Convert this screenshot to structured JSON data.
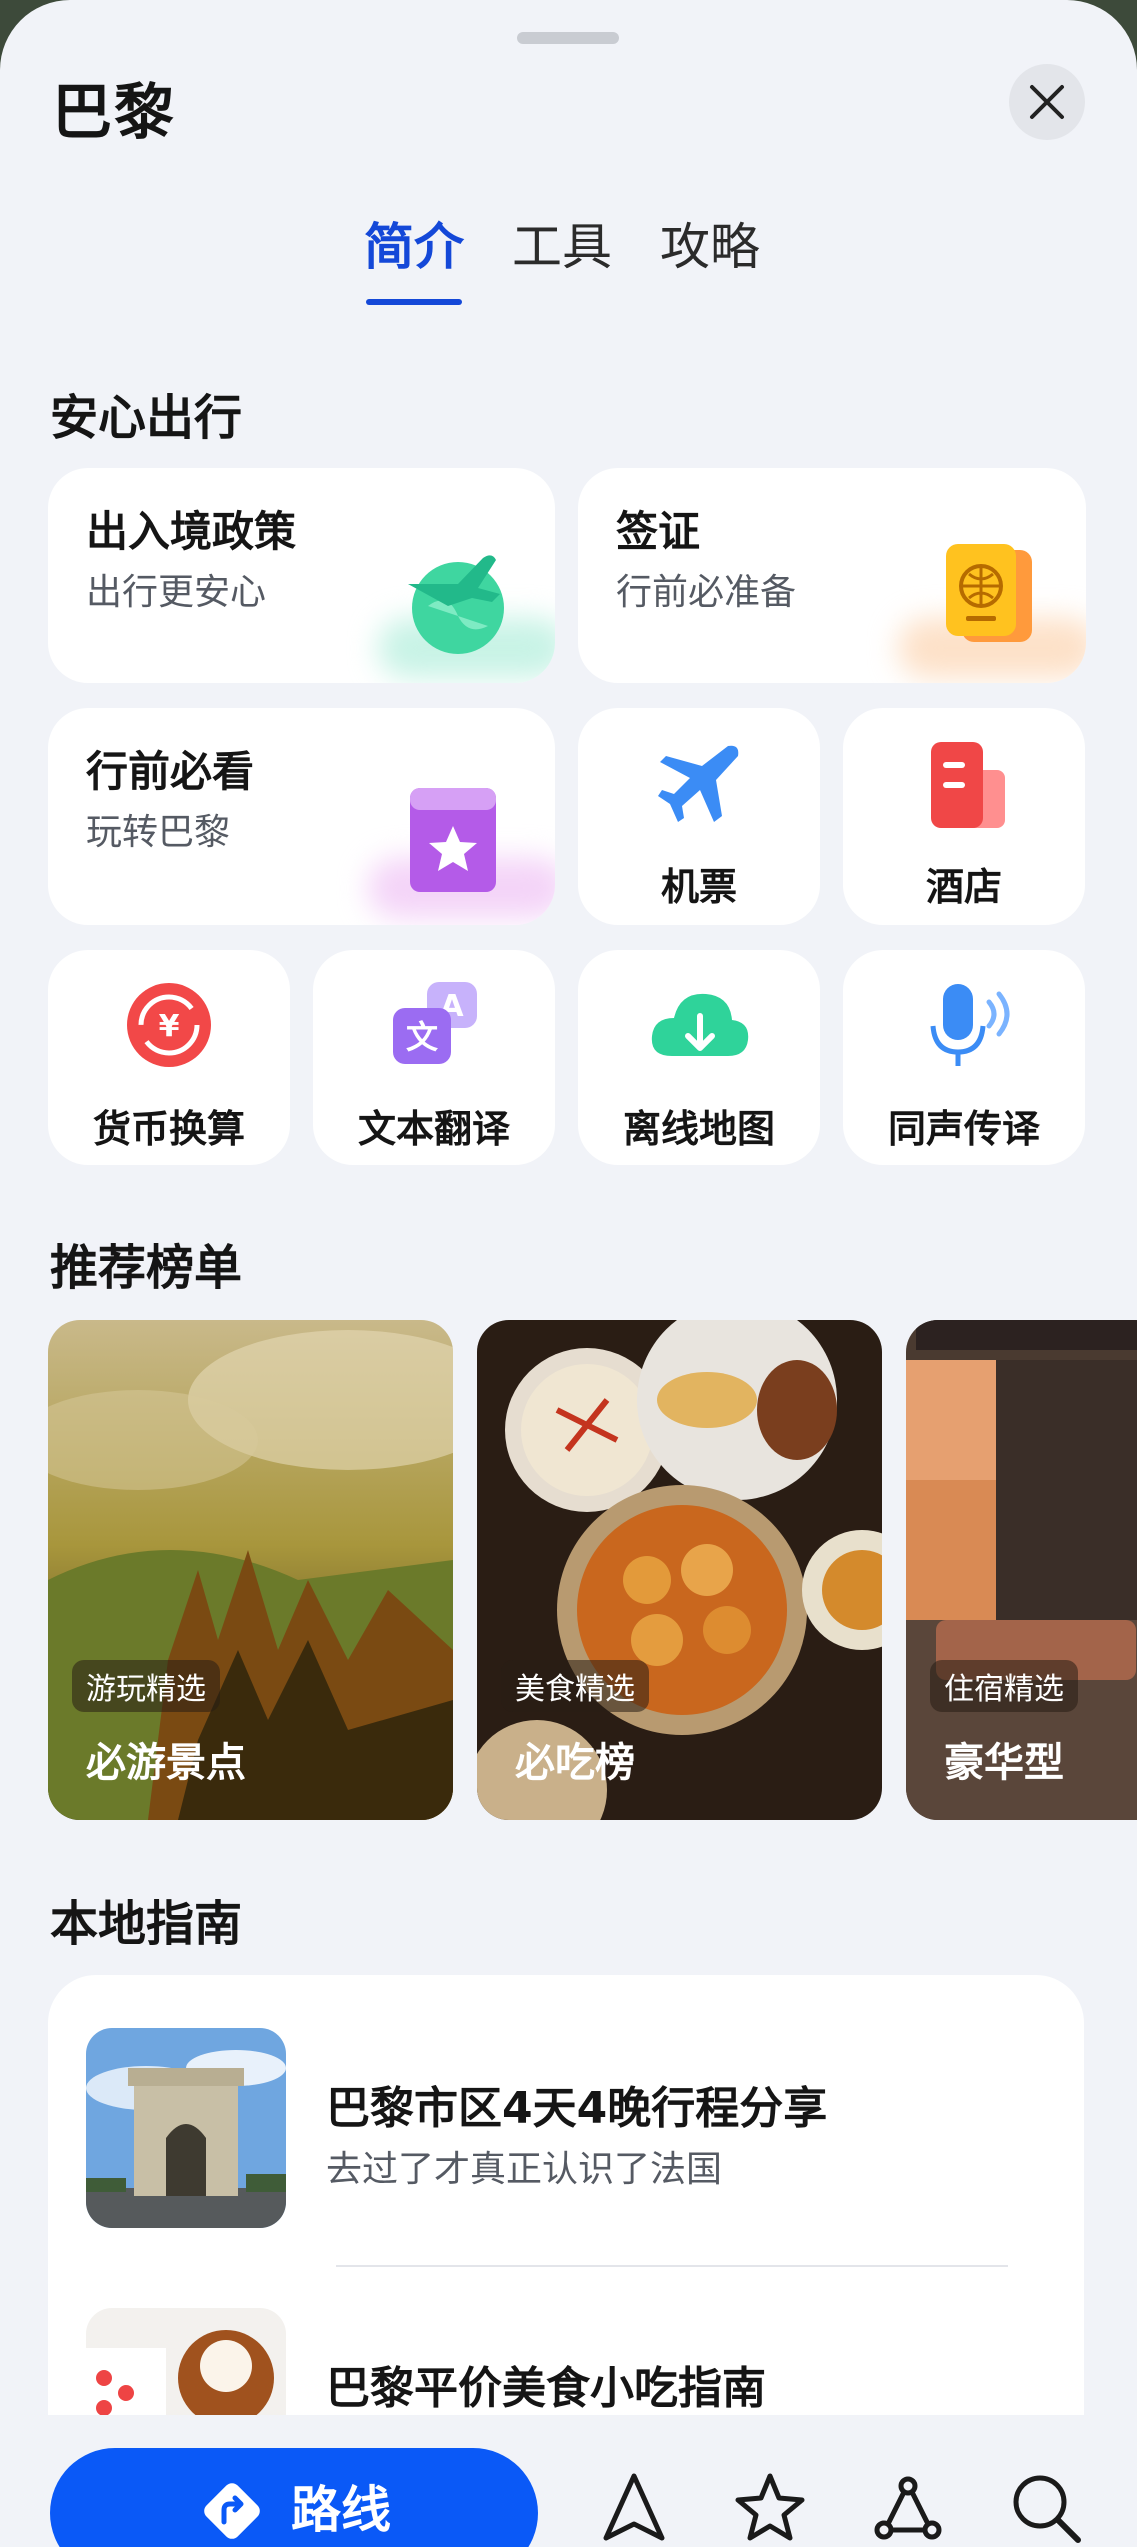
{
  "header": {
    "title": "巴黎"
  },
  "tabs": [
    {
      "label": "简介",
      "active": true
    },
    {
      "label": "工具",
      "active": false
    },
    {
      "label": "攻略",
      "active": false
    }
  ],
  "safe_travel": {
    "title": "安心出行",
    "cards": [
      {
        "title": "出入境政策",
        "subtitle": "出行更安心",
        "icon": "plane-globe-icon"
      },
      {
        "title": "签证",
        "subtitle": "行前必准备",
        "icon": "passport-icon"
      },
      {
        "title": "行前必看",
        "subtitle": "玩转巴黎",
        "icon": "bookmark-star-icon"
      }
    ],
    "tiles": [
      {
        "label": "机票",
        "icon": "airplane-icon"
      },
      {
        "label": "酒店",
        "icon": "hotel-icon"
      },
      {
        "label": "货币换算",
        "icon": "currency-exchange-icon"
      },
      {
        "label": "文本翻译",
        "icon": "translate-icon"
      },
      {
        "label": "离线地图",
        "icon": "cloud-download-icon"
      },
      {
        "label": "同声传译",
        "icon": "microphone-icon"
      }
    ]
  },
  "rankings": {
    "title": "推荐榜单",
    "items": [
      {
        "tag": "游玩精选",
        "title": "必游景点"
      },
      {
        "tag": "美食精选",
        "title": "必吃榜"
      },
      {
        "tag": "住宿精选",
        "title": "豪华型"
      }
    ]
  },
  "local_guide": {
    "title": "本地指南",
    "items": [
      {
        "title": "巴黎市区4天4晚行程分享",
        "subtitle": "去过了才真正认识了法国"
      },
      {
        "title": "巴黎平价美食小吃指南",
        "subtitle": ""
      }
    ]
  },
  "bottom_bar": {
    "route_label": "路线",
    "icons": [
      "navigate-icon",
      "star-icon",
      "route-nodes-icon",
      "search-icon"
    ]
  },
  "colors": {
    "accent": "#0a59f7",
    "tab_active": "#1448d8",
    "background": "#f1f3f8"
  }
}
